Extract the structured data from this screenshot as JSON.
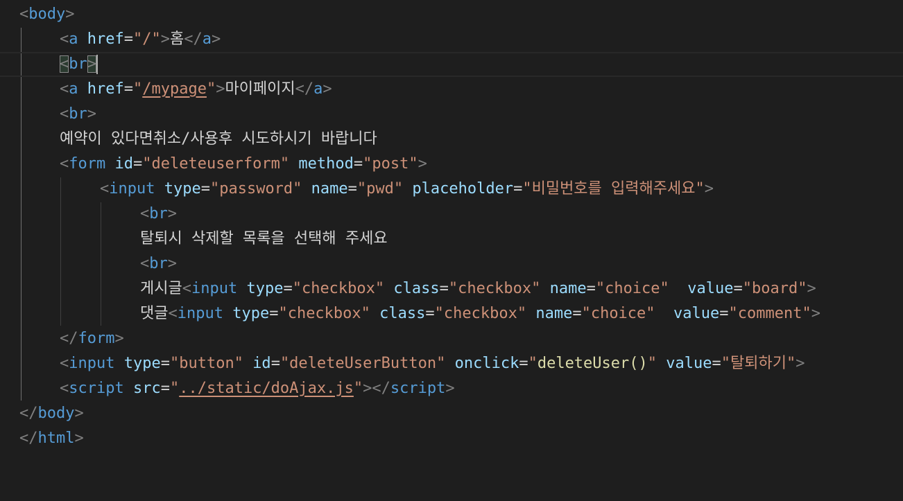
{
  "editor": {
    "language": "html",
    "theme_colors": {
      "background": "#1e1e1e",
      "tag": "#569cd6",
      "punctuation": "#808080",
      "attribute": "#9cdcfe",
      "string": "#ce9178",
      "function": "#dcdcaa",
      "text": "#d4d4d4"
    },
    "lines": [
      {
        "tokens": [
          "<",
          "body",
          ">"
        ]
      },
      {
        "tokens": [
          "<",
          "a",
          "href",
          "=",
          "\"/\"",
          ">",
          "홈",
          "</",
          "a",
          ">"
        ]
      },
      {
        "tokens": [
          "<",
          "br",
          ">"
        ]
      },
      {
        "tokens": [
          "<",
          "a",
          "href",
          "=",
          "\"",
          "/mypage",
          "\"",
          ">",
          "마이페이지",
          "</",
          "a",
          ">"
        ]
      },
      {
        "tokens": [
          "<",
          "br",
          ">"
        ]
      },
      {
        "tokens": [
          "예약이 있다면취소/사용후 시도하시기 바랍니다"
        ]
      },
      {
        "tokens": [
          "<",
          "form",
          "id",
          "=",
          "\"deleteuserform\"",
          "method",
          "=",
          "\"post\"",
          ">"
        ]
      },
      {
        "tokens": [
          "<",
          "input",
          "type",
          "=",
          "\"password\"",
          "name",
          "=",
          "\"pwd\"",
          "placeholder",
          "=",
          "\"비밀번호를 입력해주세요\"",
          ">"
        ]
      },
      {
        "tokens": [
          "<",
          "br",
          ">"
        ]
      },
      {
        "tokens": [
          "탈퇴시 삭제할 목록을 선택해 주세요"
        ]
      },
      {
        "tokens": [
          "<",
          "br",
          ">"
        ]
      },
      {
        "tokens": [
          "게시글",
          "<",
          "input",
          "type",
          "=",
          "\"checkbox\"",
          "class",
          "=",
          "\"checkbox\"",
          "name",
          "=",
          "\"choice\"",
          "value",
          "=",
          "\"board\"",
          ">"
        ]
      },
      {
        "tokens": [
          "댓글",
          "<",
          "input",
          "type",
          "=",
          "\"checkbox\"",
          "class",
          "=",
          "\"checkbox\"",
          "name",
          "=",
          "\"choice\"",
          "value",
          "=",
          "\"comment\"",
          ">"
        ]
      },
      {
        "tokens": [
          "</",
          "form",
          ">"
        ]
      },
      {
        "tokens": [
          "<",
          "input",
          "type",
          "=",
          "\"button\"",
          "id",
          "=",
          "\"deleteUserButton\"",
          "onclick",
          "=",
          "\"",
          "deleteUser()",
          "\"",
          "value",
          "=",
          "\"탈퇴하기\"",
          ">"
        ]
      },
      {
        "tokens": [
          "<",
          "script",
          "src",
          "=",
          "\"",
          "../static/doAjax.js",
          "\"",
          "></",
          "script",
          ">"
        ]
      },
      {
        "tokens": [
          "</",
          "body",
          ">"
        ]
      },
      {
        "tokens": [
          "</",
          "html",
          ">"
        ]
      }
    ]
  }
}
